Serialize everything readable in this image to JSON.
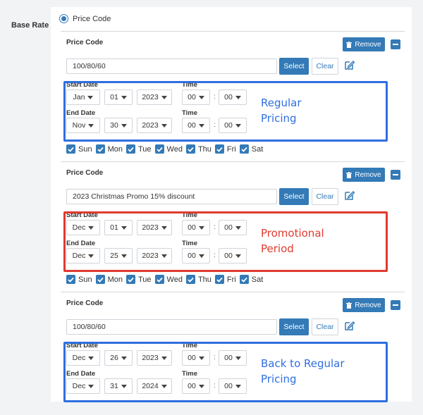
{
  "form": {
    "row_label": "Base Rate",
    "radio_label": "Price Code",
    "field_label": "Price Code",
    "remove_label": "Remove",
    "select_label": "Select",
    "clear_label": "Clear",
    "start_date_label": "Start Date",
    "end_date_label": "End Date",
    "time_label": "Time",
    "colon": ":"
  },
  "days": [
    "Sun",
    "Mon",
    "Tue",
    "Wed",
    "Thu",
    "Fri",
    "Sat"
  ],
  "blocks": [
    {
      "code": "100/80/60",
      "start": {
        "month": "Jan",
        "day": "01",
        "year": "2023",
        "hour": "00",
        "minute": "00"
      },
      "end": {
        "month": "Nov",
        "day": "30",
        "year": "2023",
        "hour": "00",
        "minute": "00"
      },
      "annotation": {
        "line1": "Regular",
        "line2": "Pricing",
        "color": "#2f6fe0"
      }
    },
    {
      "code": "2023 Christmas Promo 15% discount",
      "start": {
        "month": "Dec",
        "day": "01",
        "year": "2023",
        "hour": "00",
        "minute": "00"
      },
      "end": {
        "month": "Dec",
        "day": "25",
        "year": "2023",
        "hour": "00",
        "minute": "00"
      },
      "annotation": {
        "line1": "Promotional",
        "line2": "Period",
        "color": "#e03a2f"
      }
    },
    {
      "code": "100/80/60",
      "start": {
        "month": "Dec",
        "day": "26",
        "year": "2023",
        "hour": "00",
        "minute": "00"
      },
      "end": {
        "month": "Dec",
        "day": "31",
        "year": "2024",
        "hour": "00",
        "minute": "00"
      },
      "annotation": {
        "line1": "Back to Regular",
        "line2": "Pricing",
        "color": "#2f6fe0"
      }
    }
  ]
}
